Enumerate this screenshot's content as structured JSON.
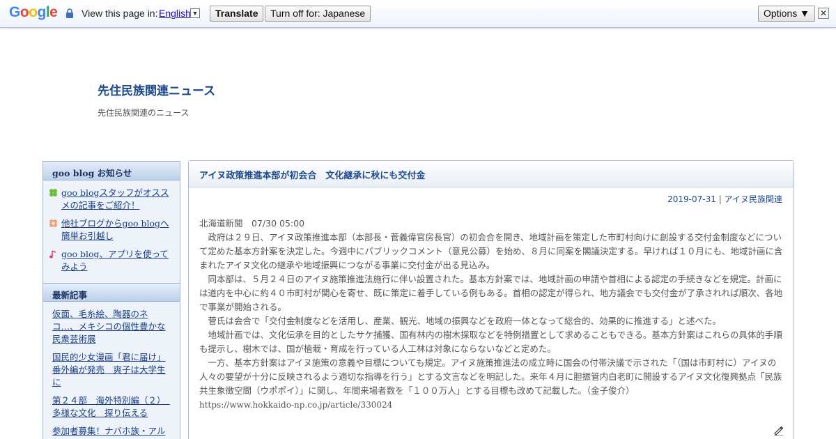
{
  "translate_bar": {
    "logo": [
      "G",
      "o",
      "o",
      "g",
      "l",
      "e"
    ],
    "logo_colors": [
      "#4285F4",
      "#EA4335",
      "#FBBC05",
      "#4285F4",
      "#34A853",
      "#EA4335"
    ],
    "prompt": "View this page in:",
    "language": "English",
    "translate_label": "Translate",
    "turn_off_label": "Turn off for: Japanese",
    "options_label": "Options ▼",
    "close_label": "✕"
  },
  "blog": {
    "title": "先住民族関連ニュース",
    "description": "先住民族関連のニュース"
  },
  "sidebar": {
    "notice_heading": "goo blog お知らせ",
    "notices": [
      {
        "label": "goo blogスタッフがオススメの記事をご紹介！",
        "icon": "clover-icon",
        "color": "#4caf3a"
      },
      {
        "label": "他社ブログからgoo blogへ簡単お引越し",
        "icon": "flower-icon",
        "color": "#f08a5d"
      },
      {
        "label": "goo blog、アプリを使ってみよう",
        "icon": "music-note-icon",
        "color": "#d63a8a"
      }
    ],
    "recent_heading": "最新記事",
    "recent": [
      "仮面、毛糸絵、陶器のネコ…、メキシコの個性豊かな民衆芸術展",
      "国民的少女漫画「君に届け」番外編が発売　爽子は大学生に",
      "第２４部　海外特別編（２）　多様な文化　探り伝える",
      "参加者募集！ナバホ族・アル"
    ]
  },
  "article": {
    "title": "アイヌ政策推進本部が初会合　文化継承に秋にも交付金",
    "date": "2019-07-31",
    "separator": "|",
    "category": "アイヌ民族関連",
    "source": "北海道新聞　07/30 05:00",
    "paragraphs": [
      "　政府は２９日、アイヌ政策推進本部（本部長・菅義偉官房長官）の初会合を開き、地域計画を策定した市町村向けに創設する交付金制度などについて定めた基本方針案を決定した。今週中にパブリックコメント（意見公募）を始め、８月に同案を閣議決定する。早ければ１０月にも、地域計画に含まれたアイヌ文化の継承や地域振興につながる事業に交付金が出る見込み。",
      "　同本部は、５月２４日のアイヌ施策推進法施行に伴い設置された。基本方針案では、地域計画の申請や首相による認定の手続きなどを規定。計画には道内を中心に約４０市町村が関心を寄せ、既に策定に着手している例もある。首相の認定が得られ、地方議会でも交付金が了承されれば順次、各地で事業が開始される。",
      "　菅氏は会合で「交付金制度などを活用し、産業、観光、地域の振興などを政府一体となって総合的、効果的に推進する」と述べた。",
      "　地域計画では、文化伝承を目的としたサケ捕獲、国有林内の樹木採取などを特例措置として求めることもできる。基本方針案はこれらの具体的手順も提示し、樹木では、国が植栽・育成を行っている人工林は対象にならないなどと定めた。",
      "　一方、基本方針案はアイヌ施策の意義や目標についても規定。アイヌ施策推進法の成立時に国会の付帯決議で示された「（国は市町村に）アイヌの人々の要望が十分に反映されるよう適切な指導を行う」とする文言などを明記した。来年４月に胆振管内白老町に開設するアイヌ文化復興拠点「民族共生象徴空間（ウポポイ）」に関し、年間来場者数を「１００万人」とする目標も改めて記載した。（金子俊介）"
    ],
    "url": "https://www.hokkaido-np.co.jp/article/330024"
  }
}
